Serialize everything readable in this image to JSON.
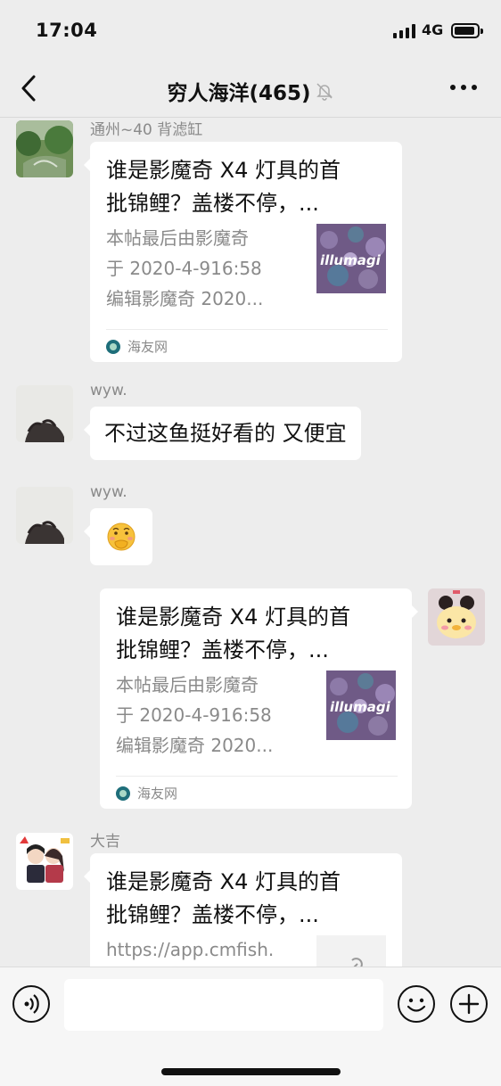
{
  "status": {
    "time": "17:04",
    "network": "4G"
  },
  "nav": {
    "title": "穷人海洋(465)",
    "back_icon": "chevron-left-icon",
    "muted_icon": "bell-muted-icon",
    "more_icon": "more-dots-icon"
  },
  "messages": [
    {
      "sender": "通州~40 背滤缸",
      "type": "link-card",
      "title_line1": "谁是影魔奇 X4 灯具的首",
      "title_line2": "批锦鲤？盖楼不停，...",
      "desc_line1": "本帖最后由影魔奇",
      "desc_line2": "于 2020-4-916:58",
      "desc_line3": "编辑影魔奇 2020...",
      "source": "海友网",
      "thumb_text": "illumagi"
    },
    {
      "sender": "wyw.",
      "type": "text",
      "text": "不过这鱼挺好看的 又便宜"
    },
    {
      "sender": "wyw.",
      "type": "emoji",
      "emoji": "🤭"
    },
    {
      "sender": "",
      "type": "link-card-self",
      "title_line1": "谁是影魔奇 X4 灯具的首",
      "title_line2": "批锦鲤？盖楼不停，...",
      "desc_line1": "本帖最后由影魔奇",
      "desc_line2": "于 2020-4-916:58",
      "desc_line3": "编辑影魔奇 2020...",
      "source": "海友网",
      "thumb_text": "illumagi"
    },
    {
      "sender": "大吉",
      "type": "link-card",
      "title_line1": "谁是影魔奇 X4 灯具的首",
      "title_line2": "批锦鲤？盖楼不停，...",
      "desc_line1": "https://app.cmfish."
    }
  ],
  "input": {
    "placeholder": "",
    "voice_icon": "voice-icon",
    "emoji_icon": "emoji-icon",
    "plus_icon": "plus-icon"
  },
  "colors": {
    "background": "#ededed",
    "bubble": "#ffffff",
    "secondary_text": "#8a8a8a"
  }
}
